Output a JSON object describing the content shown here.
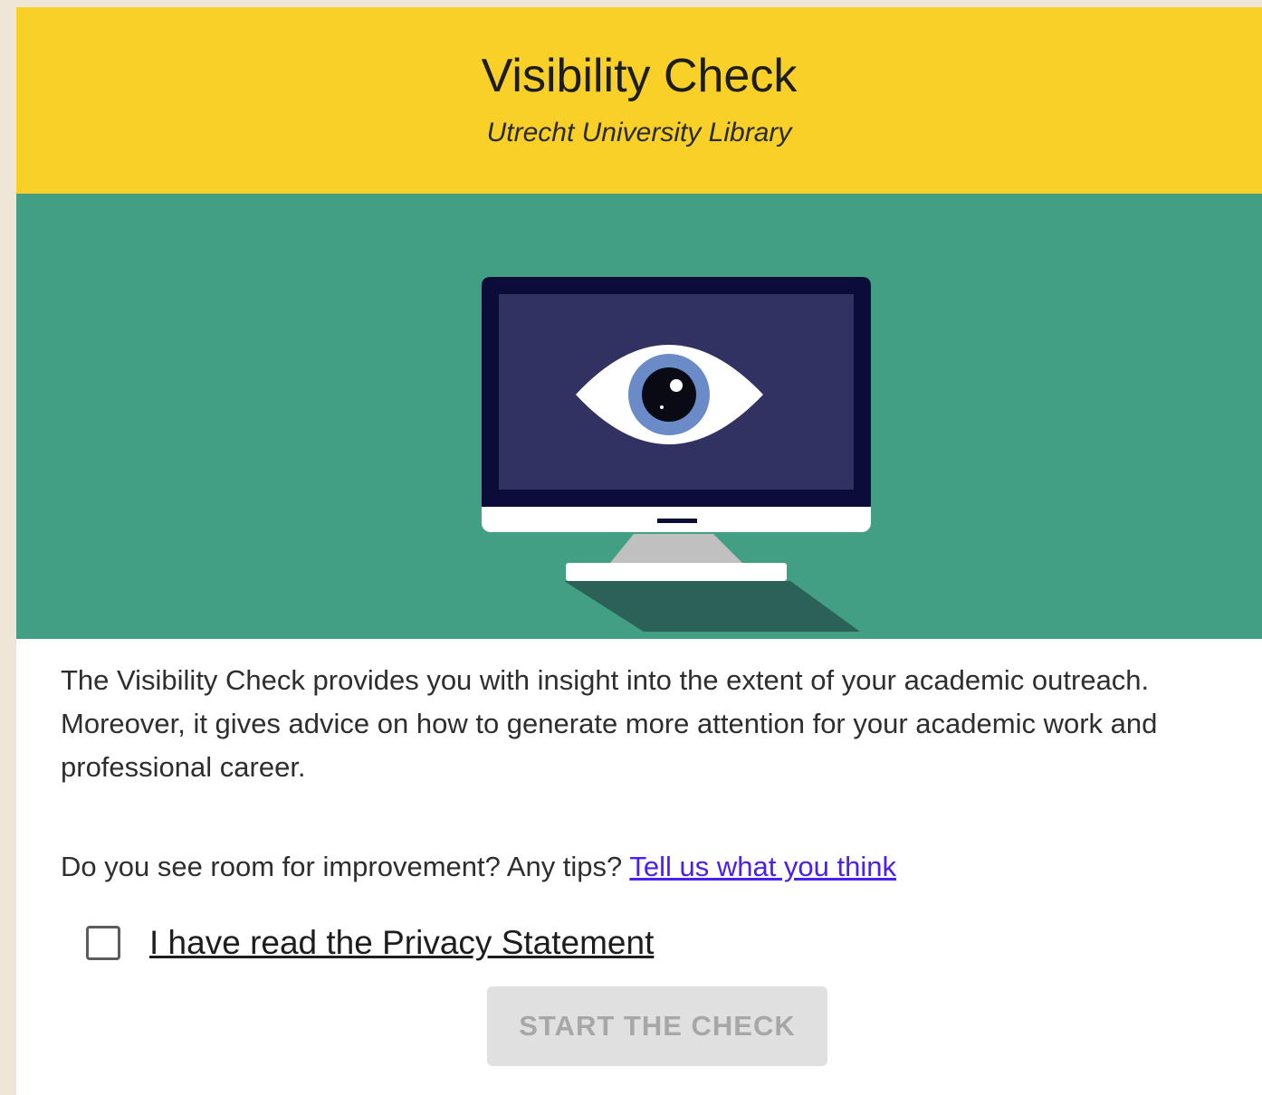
{
  "header": {
    "title": "Visibility Check",
    "subtitle": "Utrecht University Library"
  },
  "hero": {
    "illustration": "computer-monitor-with-eye",
    "background_color": "#439f84"
  },
  "intro": {
    "text": "The Visibility Check provides you with insight into the extent of your academic outreach. Moreover, it gives advice on how to generate more attention for your academic work and professional career."
  },
  "feedback": {
    "question": "Do you see room for improvement? Any tips?",
    "link_label": "Tell us what you think"
  },
  "privacy": {
    "checkbox_checked": false,
    "label": "I have read the Privacy Statement"
  },
  "start_button": {
    "label": "START THE CHECK",
    "disabled": true
  },
  "colors": {
    "header": "#f9d028",
    "hero": "#439f84",
    "link": "#4a1ff0",
    "button_disabled_bg": "#e0e0e0",
    "button_disabled_text": "#a7a7a7",
    "page_background": "#f0e6d8"
  }
}
